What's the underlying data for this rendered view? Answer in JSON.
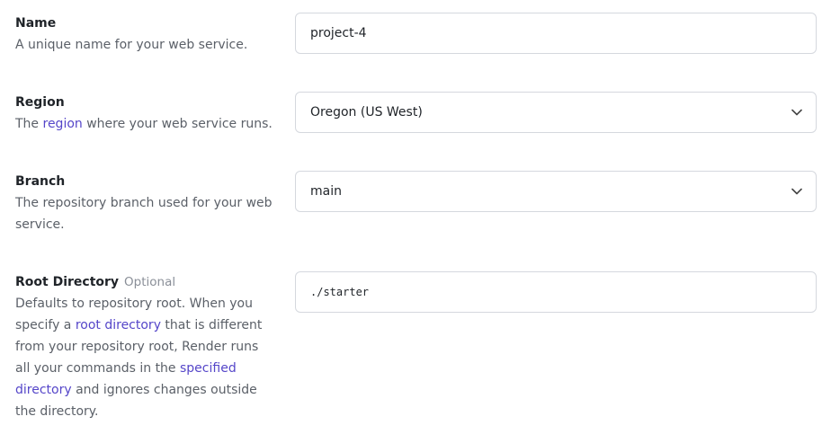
{
  "name": {
    "title": "Name",
    "description": "A unique name for your web service.",
    "value": "project-4"
  },
  "region": {
    "title": "Region",
    "desc_prefix": "The ",
    "desc_link": "region",
    "desc_suffix": " where your web service runs.",
    "value": "Oregon (US West)",
    "icon": "chevron-down-icon"
  },
  "branch": {
    "title": "Branch",
    "description": "The repository branch used for your web service.",
    "value": "main",
    "icon": "chevron-down-icon"
  },
  "root_directory": {
    "title": "Root Directory",
    "optional_label": "Optional",
    "desc_part1": "Defaults to repository root. When you specify a ",
    "desc_link1": "root directory",
    "desc_part2": " that is different from your repository root, Render runs all your commands in the ",
    "desc_link2": "specified directory",
    "desc_part3": " and ignores changes outside the directory.",
    "value": "./starter"
  },
  "colors": {
    "link": "#5546c9",
    "border": "#d5d8de"
  }
}
